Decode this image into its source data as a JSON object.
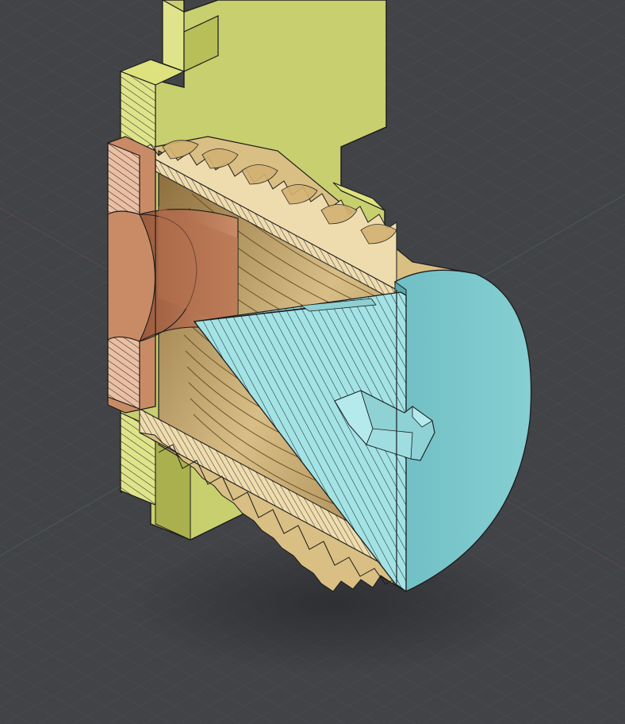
{
  "viewport": {
    "background": "#414347",
    "grid_minor": "#4b4d52",
    "grid_major": "#55585d",
    "axis_x_color": "#7a4f52",
    "axis_y_color": "#4f7a52"
  },
  "parts": {
    "bracket": {
      "color": "#c8cf6e",
      "shade": "#a9b04d",
      "section": "#dfe48a"
    },
    "nut": {
      "color": "#c98b66",
      "shade": "#a9694a",
      "section": "#ebbfa3"
    },
    "threaded_body": {
      "color": "#d9bf84",
      "shade": "#b39658",
      "section": "#efdcae"
    },
    "cap": {
      "color": "#74c3c7",
      "shade": "#5aa8ad",
      "section": "#a3e3e6"
    }
  },
  "hatch": {
    "line": "#1b1b1b"
  }
}
